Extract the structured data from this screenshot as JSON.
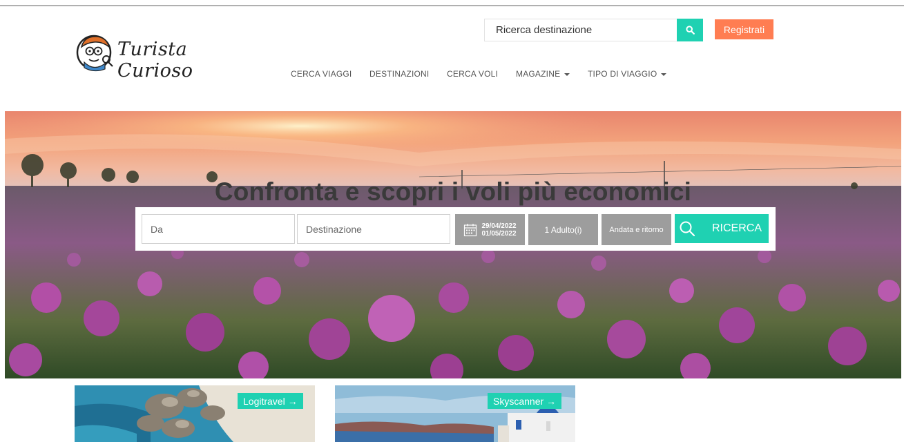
{
  "header": {
    "logo_text": "Turista Curioso",
    "search": {
      "placeholder": "Ricerca destinazione"
    },
    "register_label": "Registrati"
  },
  "nav": {
    "items": [
      {
        "label": "CERCA VIAGGI",
        "dropdown": false
      },
      {
        "label": "DESTINAZIONI",
        "dropdown": false
      },
      {
        "label": "CERCA VOLI",
        "dropdown": false
      },
      {
        "label": "MAGAZINE",
        "dropdown": true
      },
      {
        "label": "TIPO DI VIAGGIO",
        "dropdown": true
      }
    ]
  },
  "hero": {
    "title": "Confronta e scopri i voli più economici",
    "form": {
      "from_placeholder": "Da",
      "to_placeholder": "Destinazione",
      "date_depart": "29/04/2022",
      "date_return": "01/05/2022",
      "passengers": "1 Adulto(i)",
      "trip_type": "Andata e ritorno",
      "search_label": "RICERCA"
    }
  },
  "cards": [
    {
      "label": "Logitravel"
    },
    {
      "label": "Skyscanner"
    }
  ],
  "colors": {
    "accent": "#1fd1b2",
    "register": "#ff7d52",
    "form_grey": "#9d9d9d"
  }
}
